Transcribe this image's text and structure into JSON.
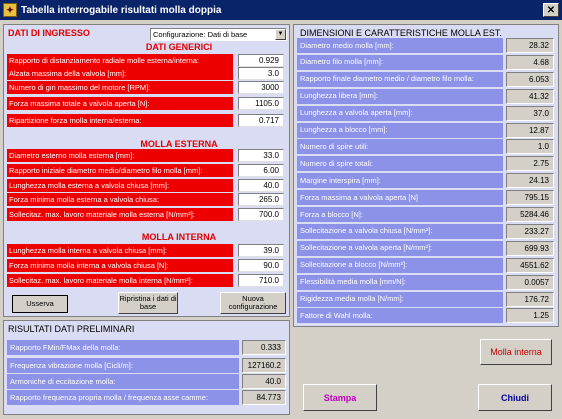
{
  "window": {
    "title": "Tabella interrogabile risultati molla doppia",
    "close": "✕"
  },
  "input": {
    "heading": "DATI DI INGRESSO",
    "config_select": "Configurazione: Dati di base",
    "generic_title": "DATI GENERICI",
    "generic": [
      {
        "label": "Rapporto di distanziamento radiale molle esterna/interna:",
        "value": "0.929"
      },
      {
        "label": "Alzata massima della valvola [mm]:",
        "value": "3.0"
      },
      {
        "label": "Numero di giri massimo del motore [RPM]:",
        "value": "3000"
      },
      {
        "label": "Forza massima totale a valvola aperta [N]:",
        "value": "1105.0"
      },
      {
        "label": "Ripartizione forza molla interna/esterna:",
        "value": "0.717"
      }
    ],
    "outer_title": "MOLLA ESTERNA",
    "outer": [
      {
        "label": "Diametro esterno molla esterna [mm]:",
        "value": "33.0"
      },
      {
        "label": "Rapporto iniziale diametro medio/diametro filo molla [mm]:",
        "value": "6.00"
      },
      {
        "label": "Lunghezza molla esterna a valvola chiusa [mm]:",
        "value": "40.0"
      },
      {
        "label": "Forza minima molla esterna a valvola chiusa:",
        "value": "265.0"
      },
      {
        "label": "Sollecitaz. max. lavoro materiale molla esterna [N/mm²]:",
        "value": "700.0"
      }
    ],
    "inner_title": "MOLLA INTERNA",
    "inner": [
      {
        "label": "Lunghezza molla interna a valvola chiusa [mm]:",
        "value": "39.0"
      },
      {
        "label": "Forza minima molla interna a valvola chiusa [N]:",
        "value": "90.0"
      },
      {
        "label": "Sollecitaz. max. lavoro materiale molla interna [N/mm²]:",
        "value": "710.0"
      }
    ],
    "buttons": {
      "use": "Usserva",
      "restore": "Ripristina i dati di base",
      "new": "Nuova configurazione"
    }
  },
  "prelim": {
    "title": "RISULTATI DATI PRELIMINARI",
    "rows": [
      {
        "label": "Rapporto FMin/FMax della molla:",
        "value": "0.333"
      },
      {
        "label": "Frequenza vibrazione molla [Cicli/m]:",
        "value": "127160.2"
      },
      {
        "label": "Armoniche di eccitazione molla:",
        "value": "40.0"
      },
      {
        "label": "Rapporto frequenza propria molla / frequenza asse camme:",
        "value": "84.773"
      }
    ]
  },
  "dims": {
    "title": "DIMENSIONI E CARATTERISTICHE MOLLA EST.",
    "rows": [
      {
        "label": "Diametro medio molla [mm]:",
        "value": "28.32"
      },
      {
        "label": "Diametro filo molla [mm]:",
        "value": "4.68"
      },
      {
        "label": "Rapporto finale diametro medio / diametro filo molla:",
        "value": "6.053"
      },
      {
        "label": "Lunghezza libera [mm]:",
        "value": "41.32"
      },
      {
        "label": "Lunghezza a valvola aperta [mm]:",
        "value": "37.0"
      },
      {
        "label": "Lunghezza a blocco [mm]:",
        "value": "12.87"
      },
      {
        "label": "Numero di spire utili:",
        "value": "1.0"
      },
      {
        "label": " Numero di spire totali:",
        "value": "2.75"
      },
      {
        "label": "Margine interspira [mm]:",
        "value": "24.13"
      },
      {
        "label": "Forza massima a valvola aperta [N]",
        "value": "795.15"
      },
      {
        "label": "Forza a blocco [N]:",
        "value": "5284.46"
      },
      {
        "label": "Sollecitazione a valvola chiusa [N/mm²]:",
        "value": "233.27"
      },
      {
        "label": "Sollecitazione a valvola aperta [N/mm²]:",
        "value": "699.93"
      },
      {
        "label": "Sollecitazione a blocco [N/mm²]:",
        "value": "4551.62"
      },
      {
        "label": "Flessibilità media molla [mm/N]:",
        "value": "0.0057"
      },
      {
        "label": "Rigidezza media molla [N/mm]:",
        "value": "176.72"
      },
      {
        "label": "Fattore di Wahl molla:",
        "value": "1.25"
      }
    ]
  },
  "actions": {
    "inner_spring": "Molla interna",
    "print": "Stampa",
    "close": "Chiudi"
  },
  "colors": {
    "title_bar": "#0a246a",
    "input_label": "#ee0000",
    "result_label": "#8b92e8",
    "panel": "#d9dcf2"
  }
}
